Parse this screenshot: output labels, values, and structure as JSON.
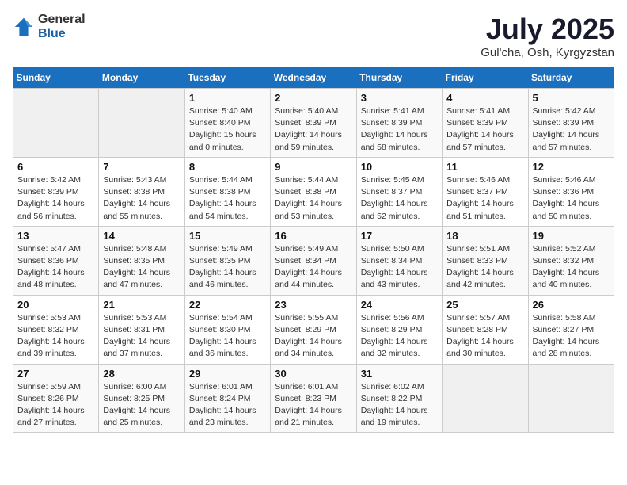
{
  "logo": {
    "general": "General",
    "blue": "Blue"
  },
  "header": {
    "title": "July 2025",
    "subtitle": "Gul'cha, Osh, Kyrgyzstan"
  },
  "weekdays": [
    "Sunday",
    "Monday",
    "Tuesday",
    "Wednesday",
    "Thursday",
    "Friday",
    "Saturday"
  ],
  "weeks": [
    [
      {
        "day": "",
        "info": ""
      },
      {
        "day": "",
        "info": ""
      },
      {
        "day": "1",
        "info": "Sunrise: 5:40 AM\nSunset: 8:40 PM\nDaylight: 15 hours and 0 minutes."
      },
      {
        "day": "2",
        "info": "Sunrise: 5:40 AM\nSunset: 8:39 PM\nDaylight: 14 hours and 59 minutes."
      },
      {
        "day": "3",
        "info": "Sunrise: 5:41 AM\nSunset: 8:39 PM\nDaylight: 14 hours and 58 minutes."
      },
      {
        "day": "4",
        "info": "Sunrise: 5:41 AM\nSunset: 8:39 PM\nDaylight: 14 hours and 57 minutes."
      },
      {
        "day": "5",
        "info": "Sunrise: 5:42 AM\nSunset: 8:39 PM\nDaylight: 14 hours and 57 minutes."
      }
    ],
    [
      {
        "day": "6",
        "info": "Sunrise: 5:42 AM\nSunset: 8:39 PM\nDaylight: 14 hours and 56 minutes."
      },
      {
        "day": "7",
        "info": "Sunrise: 5:43 AM\nSunset: 8:38 PM\nDaylight: 14 hours and 55 minutes."
      },
      {
        "day": "8",
        "info": "Sunrise: 5:44 AM\nSunset: 8:38 PM\nDaylight: 14 hours and 54 minutes."
      },
      {
        "day": "9",
        "info": "Sunrise: 5:44 AM\nSunset: 8:38 PM\nDaylight: 14 hours and 53 minutes."
      },
      {
        "day": "10",
        "info": "Sunrise: 5:45 AM\nSunset: 8:37 PM\nDaylight: 14 hours and 52 minutes."
      },
      {
        "day": "11",
        "info": "Sunrise: 5:46 AM\nSunset: 8:37 PM\nDaylight: 14 hours and 51 minutes."
      },
      {
        "day": "12",
        "info": "Sunrise: 5:46 AM\nSunset: 8:36 PM\nDaylight: 14 hours and 50 minutes."
      }
    ],
    [
      {
        "day": "13",
        "info": "Sunrise: 5:47 AM\nSunset: 8:36 PM\nDaylight: 14 hours and 48 minutes."
      },
      {
        "day": "14",
        "info": "Sunrise: 5:48 AM\nSunset: 8:35 PM\nDaylight: 14 hours and 47 minutes."
      },
      {
        "day": "15",
        "info": "Sunrise: 5:49 AM\nSunset: 8:35 PM\nDaylight: 14 hours and 46 minutes."
      },
      {
        "day": "16",
        "info": "Sunrise: 5:49 AM\nSunset: 8:34 PM\nDaylight: 14 hours and 44 minutes."
      },
      {
        "day": "17",
        "info": "Sunrise: 5:50 AM\nSunset: 8:34 PM\nDaylight: 14 hours and 43 minutes."
      },
      {
        "day": "18",
        "info": "Sunrise: 5:51 AM\nSunset: 8:33 PM\nDaylight: 14 hours and 42 minutes."
      },
      {
        "day": "19",
        "info": "Sunrise: 5:52 AM\nSunset: 8:32 PM\nDaylight: 14 hours and 40 minutes."
      }
    ],
    [
      {
        "day": "20",
        "info": "Sunrise: 5:53 AM\nSunset: 8:32 PM\nDaylight: 14 hours and 39 minutes."
      },
      {
        "day": "21",
        "info": "Sunrise: 5:53 AM\nSunset: 8:31 PM\nDaylight: 14 hours and 37 minutes."
      },
      {
        "day": "22",
        "info": "Sunrise: 5:54 AM\nSunset: 8:30 PM\nDaylight: 14 hours and 36 minutes."
      },
      {
        "day": "23",
        "info": "Sunrise: 5:55 AM\nSunset: 8:29 PM\nDaylight: 14 hours and 34 minutes."
      },
      {
        "day": "24",
        "info": "Sunrise: 5:56 AM\nSunset: 8:29 PM\nDaylight: 14 hours and 32 minutes."
      },
      {
        "day": "25",
        "info": "Sunrise: 5:57 AM\nSunset: 8:28 PM\nDaylight: 14 hours and 30 minutes."
      },
      {
        "day": "26",
        "info": "Sunrise: 5:58 AM\nSunset: 8:27 PM\nDaylight: 14 hours and 28 minutes."
      }
    ],
    [
      {
        "day": "27",
        "info": "Sunrise: 5:59 AM\nSunset: 8:26 PM\nDaylight: 14 hours and 27 minutes."
      },
      {
        "day": "28",
        "info": "Sunrise: 6:00 AM\nSunset: 8:25 PM\nDaylight: 14 hours and 25 minutes."
      },
      {
        "day": "29",
        "info": "Sunrise: 6:01 AM\nSunset: 8:24 PM\nDaylight: 14 hours and 23 minutes."
      },
      {
        "day": "30",
        "info": "Sunrise: 6:01 AM\nSunset: 8:23 PM\nDaylight: 14 hours and 21 minutes."
      },
      {
        "day": "31",
        "info": "Sunrise: 6:02 AM\nSunset: 8:22 PM\nDaylight: 14 hours and 19 minutes."
      },
      {
        "day": "",
        "info": ""
      },
      {
        "day": "",
        "info": ""
      }
    ]
  ]
}
